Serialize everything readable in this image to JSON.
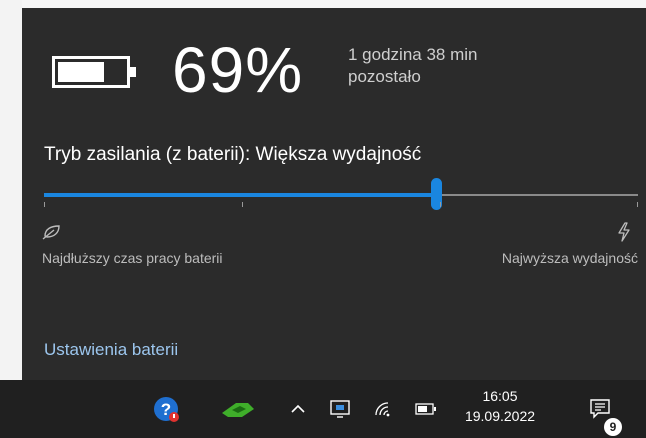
{
  "battery": {
    "percent_text": "69%",
    "level_fraction": 0.69,
    "remaining_line1": "1 godzina 38 min",
    "remaining_line2": "pozostało"
  },
  "power_mode": {
    "title": "Tryb zasilania (z baterii): Większa wydajność",
    "slider_position_fraction": 0.66,
    "slider_ticks": 4,
    "label_left": "Najdłuższy czas pracy baterii",
    "label_right": "Najwyższa wydajność",
    "left_icon": "leaf-battery-saver-icon",
    "right_icon": "lightning-bolt-icon"
  },
  "settings_link": "Ustawienia baterii",
  "colors": {
    "flyout_bg": "#2b2b2b",
    "taskbar_bg": "#202020",
    "accent": "#1a86e0",
    "link": "#9cc6ee"
  },
  "taskbar": {
    "icons": [
      "help-icon",
      "nvidia-icon",
      "show-hidden-icons-chevron",
      "display-icon",
      "wifi-icon",
      "battery-icon",
      "notifications-icon"
    ],
    "time": "16:05",
    "date": "19.09.2022",
    "notification_count": "9"
  }
}
